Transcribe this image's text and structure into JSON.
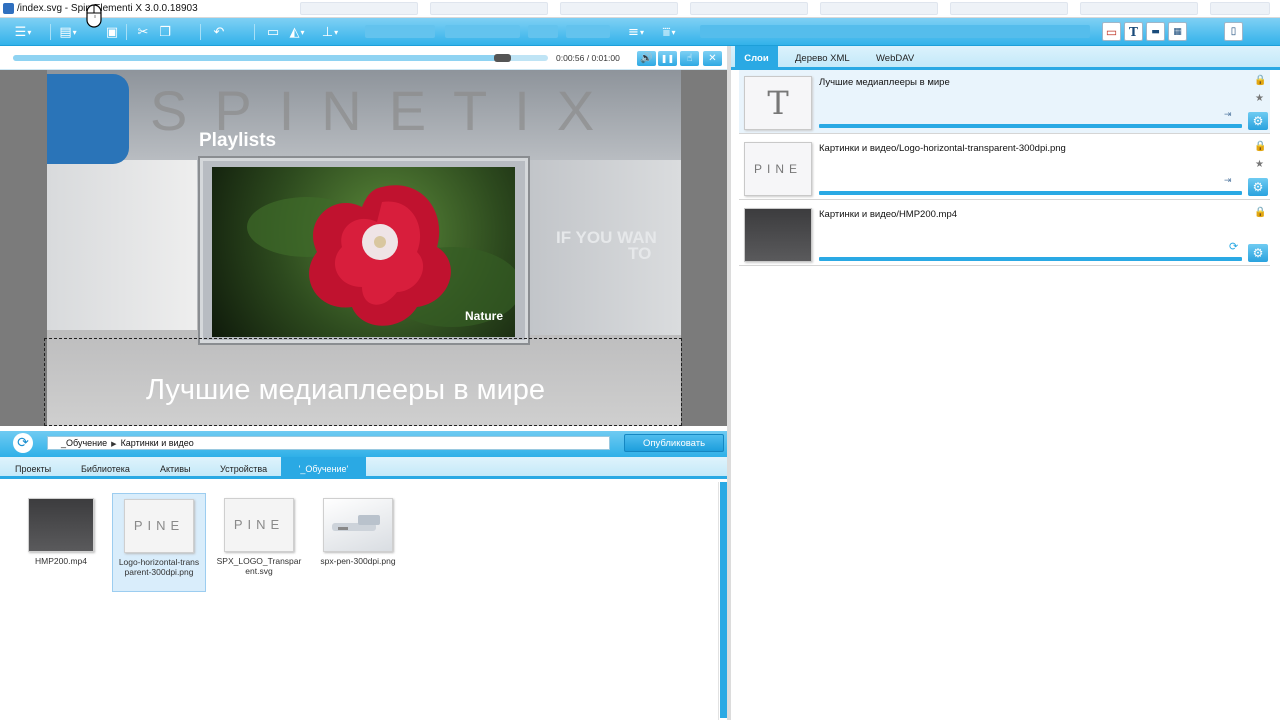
{
  "window": {
    "title": "/index.svg - Spin",
    "title_rest": " Elementi X 3.0.0.18903"
  },
  "toolbar": {
    "icons": [
      "menu-icon",
      "new-document-icon",
      "save-icon",
      "cut-icon",
      "copy-icon",
      "undo-icon",
      "insert-image-icon",
      "align-icon",
      "distribute-icon",
      "list-icon",
      "filter-icon",
      "remove-layer-icon",
      "add-text-layer-icon",
      "add-layer-icon",
      "add-media-layer-icon",
      "document-icon"
    ]
  },
  "playback": {
    "time": "0:00:56 / 0:01:00",
    "progress": 0.93,
    "buttons": {
      "volume": "🔊",
      "pause": "❚❚",
      "touch": "☝",
      "close": "✕"
    }
  },
  "preview": {
    "brand_text": "SPINETIX",
    "playlists_text": "Playlists",
    "photo_label": "Nature",
    "side_text_line1": "IF YOU WAN",
    "side_text_line2": "TO",
    "caption": "Лучшие медиаплееры в мире"
  },
  "pathbar": {
    "refresh_glyph": "⟳",
    "crumbs": [
      "_Обучение",
      "Картинки и видео"
    ],
    "publish_label": "Опубликовать"
  },
  "bottom_tabs": [
    {
      "label": "Проекты",
      "active": false
    },
    {
      "label": "Библиотека",
      "active": false
    },
    {
      "label": "Активы",
      "active": false
    },
    {
      "label": "Устройства",
      "active": false
    },
    {
      "label": "'_Обучение'",
      "active": true
    }
  ],
  "assets": [
    {
      "name": "HMP200.mp4",
      "thumb_text": "",
      "selected": false
    },
    {
      "name": "Logo-horizontal-transparent-300dpi.png",
      "thumb_text": "PINE",
      "selected": true
    },
    {
      "name": "SPX_LOGO_Transparent.svg",
      "thumb_text": "PINE",
      "selected": false
    },
    {
      "name": "spx-pen-300dpi.png",
      "thumb_text": "",
      "selected": false
    }
  ],
  "right_tabs": [
    {
      "label": "Слои",
      "active": true
    },
    {
      "label": "Дерево XML",
      "active": false
    },
    {
      "label": "WebDAV",
      "active": false
    }
  ],
  "layers": [
    {
      "name": "Лучшие медиаплееры в мире",
      "thumb_text": "T",
      "selected": true
    },
    {
      "name": "Картинки и видео/Logo-horizontal-transparent-300dpi.png",
      "thumb_text": "PINE",
      "selected": false
    },
    {
      "name": "Картинки и видео/HMP200.mp4",
      "thumb_text": "",
      "selected": false
    }
  ],
  "colors": {
    "accent": "#2aa9e4",
    "toolbar_top": "#7fd0f4",
    "toolbar_bottom": "#33b2ea",
    "selection": "#e9f4fc"
  }
}
